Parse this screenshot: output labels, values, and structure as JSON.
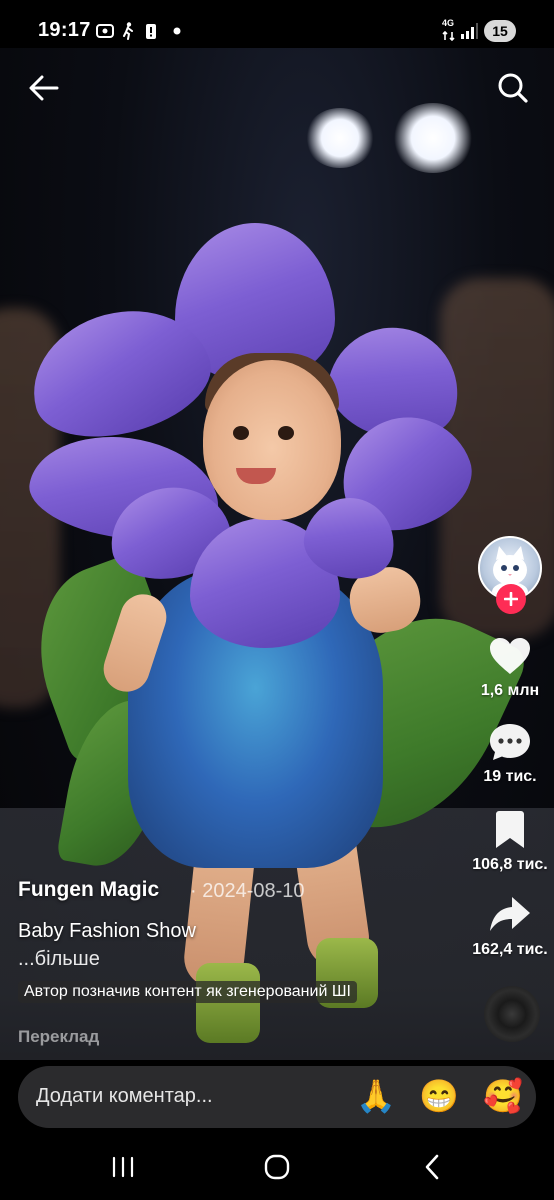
{
  "status_bar": {
    "time": "19:17",
    "network_type": "4G",
    "battery_level": "15"
  },
  "video": {
    "author": "Fungen Magic",
    "date": "· 2024-08-10",
    "caption": "Baby Fashion Show",
    "more_label": "...більше",
    "ai_label": "Автор позначив контент як згенерований ШІ",
    "translate_label": "Переклад"
  },
  "actions": {
    "likes": "1,6 млн",
    "comments": "19 тис.",
    "saves": "106,8 тис.",
    "shares": "162,4 тис."
  },
  "comment_bar": {
    "placeholder": "Додати коментар...",
    "emojis": [
      "🙏",
      "😁",
      "🥰"
    ]
  },
  "icons": {
    "back": "arrow-left-icon",
    "search": "search-icon",
    "like": "heart-icon",
    "comment": "comment-bubble-icon",
    "save": "bookmark-icon",
    "share": "share-arrow-icon",
    "nav_recents": "recents-icon",
    "nav_home": "home-icon",
    "nav_back": "back-chevron-icon"
  },
  "colors": {
    "follow_accent": "#fe2c55",
    "comment_pill": "#2b2b2d"
  }
}
